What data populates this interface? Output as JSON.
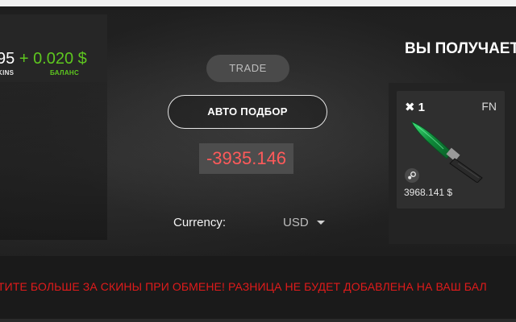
{
  "left_stats": {
    "skins_count": "95",
    "plus_sign": "+",
    "balance": "0.020 $",
    "skins_label": "KINS",
    "balance_label": "БАЛАНС"
  },
  "center": {
    "trade_label": "TRADE",
    "auto_select_label": "АВТО ПОДБОР",
    "difference_value": "-3935.146",
    "currency_label": "Currency:",
    "currency_value": "USD"
  },
  "right": {
    "heading": "ВЫ ПОЛУЧАЕТ",
    "item": {
      "quantity_prefix": "✖",
      "quantity": "1",
      "wear": "FN",
      "price": "3968.141 $",
      "icon": "knife-emerald"
    }
  },
  "warning": {
    "text": "ТИТЕ БОЛЬШЕ ЗА СКИНЫ ПРИ ОБМЕНЕ! РАЗНИЦА НЕ БУДЕТ ДОБАВЛЕНА НА ВАШ БАЛ"
  },
  "colors": {
    "balance_green": "#5ec71f",
    "difference_red": "#ff5a5a",
    "warning_red": "#e01b1b"
  }
}
